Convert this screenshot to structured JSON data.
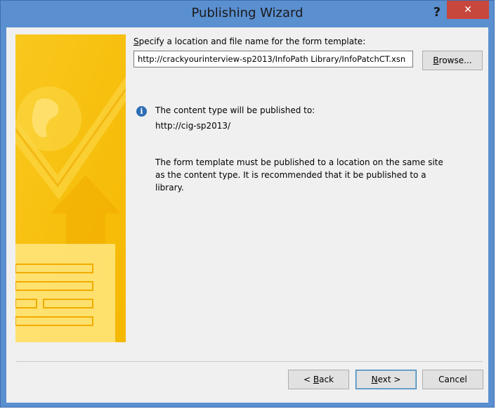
{
  "window": {
    "title": "Publishing Wizard",
    "help_glyph": "?",
    "close_glyph": "✕"
  },
  "location": {
    "label_prefix": "",
    "label_accel": "S",
    "label_rest": "pecify a location and file name for the form template:",
    "value": "http://crackyourinterview-sp2013/InfoPath Library/InfoPatchCT.xsn"
  },
  "buttons": {
    "browse_accel": "B",
    "browse_rest": "rowse...",
    "back_prefix": "< ",
    "back_accel": "B",
    "back_rest": "ack",
    "next_accel": "N",
    "next_rest": "ext >",
    "cancel": "Cancel"
  },
  "info": {
    "line1": "The content type will be published to:",
    "line2": "http://cig-sp2013/",
    "paragraph": "The form template must be published to a location on the same site as the content type. It is recommended that it be published to a library."
  },
  "icons": {
    "info": "info-icon",
    "help": "help-icon",
    "close": "close-icon"
  },
  "colors": {
    "titlebar": "#5a8fd0",
    "close": "#c7473d",
    "banner": "#f7c21a"
  }
}
